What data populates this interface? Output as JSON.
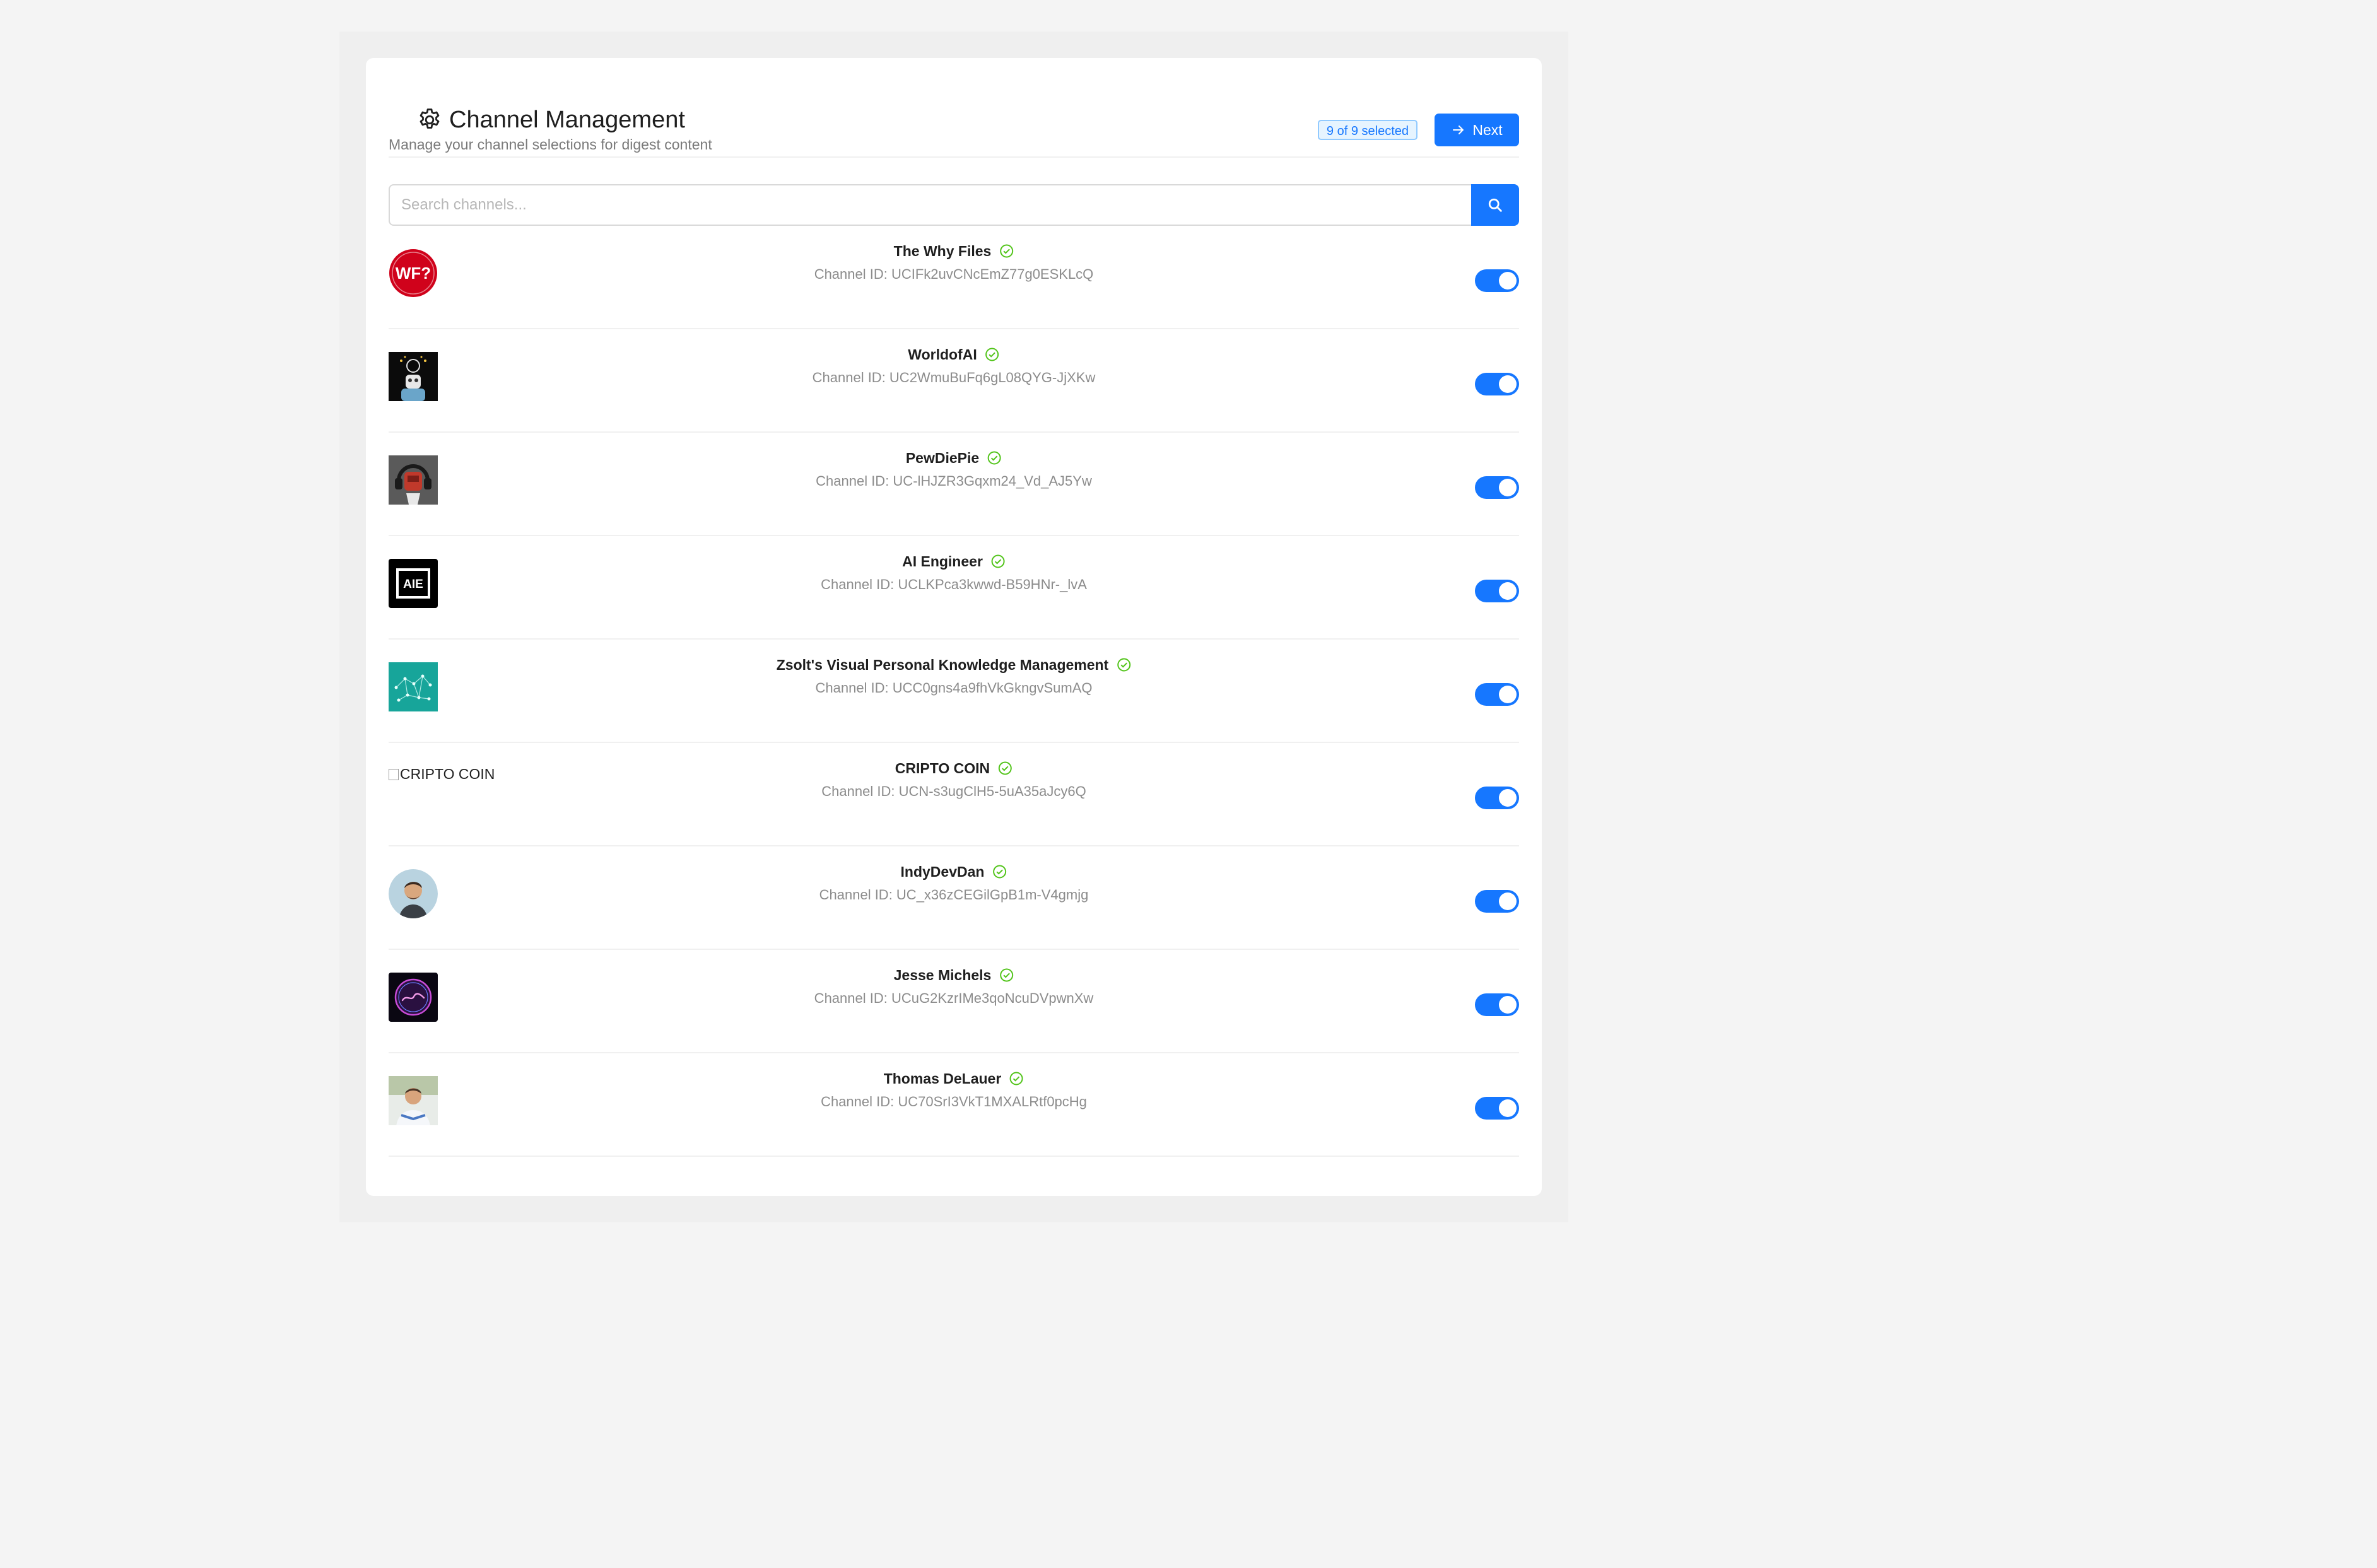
{
  "header": {
    "title": "Channel Management",
    "subtitle": "Manage your channel selections for digest content",
    "selected_badge": "9 of 9 selected",
    "next_label": "Next"
  },
  "search": {
    "placeholder": "Search channels..."
  },
  "colors": {
    "accent": "#1677ff",
    "verified": "#52c41a",
    "muted_text": "#8c8c8c"
  },
  "channels": [
    {
      "name": "The Why Files",
      "id_text": "Channel ID: UCIFk2uvCNcEmZ77g0ESKLcQ",
      "enabled": true
    },
    {
      "name": "WorldofAI",
      "id_text": "Channel ID: UC2WmuBuFq6gL08QYG-JjXKw",
      "enabled": true
    },
    {
      "name": "PewDiePie",
      "id_text": "Channel ID: UC-lHJZR3Gqxm24_Vd_AJ5Yw",
      "enabled": true
    },
    {
      "name": "AI Engineer",
      "id_text": "Channel ID: UCLKPca3kwwd-B59HNr-_lvA",
      "enabled": true
    },
    {
      "name": "Zsolt's Visual Personal Knowledge Management",
      "id_text": "Channel ID: UCC0gns4a9fhVkGkngvSumAQ",
      "enabled": true
    },
    {
      "name": "CRIPTO COIN",
      "id_text": "Channel ID: UCN-s3ugClH5-5uA35aJcy6Q",
      "enabled": true,
      "avatar_alt": "CRIPTO COIN"
    },
    {
      "name": "IndyDevDan",
      "id_text": "Channel ID: UC_x36zCEGilGpB1m-V4gmjg",
      "enabled": true
    },
    {
      "name": "Jesse Michels",
      "id_text": "Channel ID: UCuG2KzrIMe3qoNcuDVpwnXw",
      "enabled": true
    },
    {
      "name": "Thomas DeLauer",
      "id_text": "Channel ID: UC70SrI3VkT1MXALRtf0pcHg",
      "enabled": true
    }
  ]
}
